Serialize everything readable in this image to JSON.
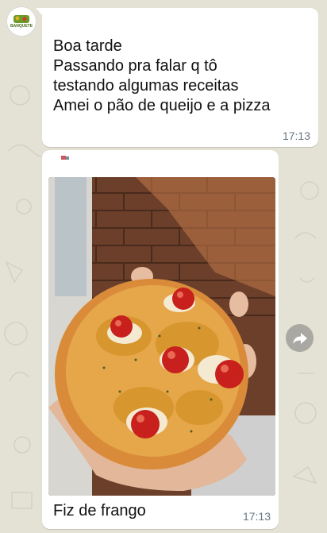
{
  "chat": {
    "avatar_text": "BANQUETE",
    "message1": {
      "text": "Boa tarde\nPassando pra falar q tô\ntestando algumas receitas\nAmei o pão de queijo e a pizza",
      "time": "17:13"
    },
    "message2": {
      "caption": "Fiz de frango",
      "time": "17:13",
      "image_icon": "pizza-photo"
    }
  },
  "colors": {
    "wallpaper": "#e4e2d4",
    "bubble": "#ffffff",
    "timestamp": "#667781"
  },
  "icons": {
    "share": "forward-share-icon"
  }
}
